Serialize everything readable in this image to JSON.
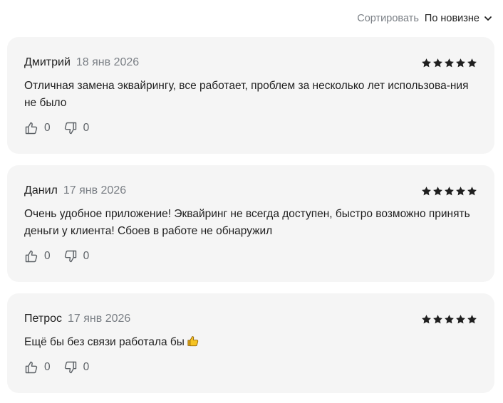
{
  "sort": {
    "label": "Сортировать",
    "selected": "По новизне",
    "chevron_icon": "chevron-down-icon"
  },
  "colors": {
    "card_background": "#f5f5f5",
    "star": "#1f1f1f",
    "muted_text": "#7a7f85",
    "emoji_yellow": "#f5c322"
  },
  "reviews": [
    {
      "author": "Дмитрий",
      "date": "18 янв 2026",
      "rating": 5,
      "text": "Отличная замена эквайрингу, все работает, проблем за несколько лет использова-ния не было",
      "likes": "0",
      "dislikes": "0"
    },
    {
      "author": "Данил",
      "date": "17 янв 2026",
      "rating": 5,
      "text": "Очень удобное приложение! Эквайринг не всегда доступен, быстро возможно принять деньги у клиента! Сбоев в работе не обнаружил",
      "likes": "0",
      "dislikes": "0"
    },
    {
      "author": "Петрос",
      "date": "17 янв 2026",
      "rating": 5,
      "text": "Ещё бы без связи работала бы",
      "emoji": "thumbs-up-emoji",
      "likes": "0",
      "dislikes": "0"
    }
  ]
}
